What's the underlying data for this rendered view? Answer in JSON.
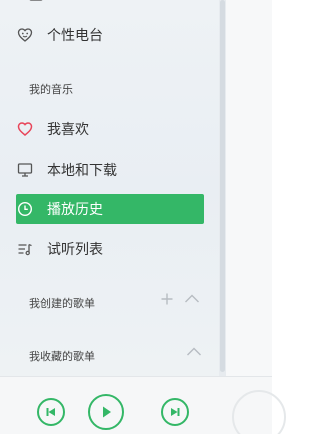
{
  "sidebar": {
    "top_items": [
      {
        "label": "个性电台",
        "icon": "radio-icon"
      }
    ],
    "my_music_title": "我的音乐",
    "my_music_items": [
      {
        "label": "我喜欢",
        "icon": "heart-icon"
      },
      {
        "label": "本地和下载",
        "icon": "monitor-icon"
      },
      {
        "label": "播放历史",
        "icon": "clock-icon",
        "active": true
      },
      {
        "label": "试听列表",
        "icon": "playlist-icon"
      }
    ],
    "created_playlists_title": "我创建的歌单",
    "collected_playlists_title": "我收藏的歌单"
  },
  "player": {
    "prev_icon": "previous-track-icon",
    "play_icon": "play-icon",
    "next_icon": "next-track-icon"
  },
  "colors": {
    "accent": "#34b767",
    "heart": "#e8455a",
    "muted": "#b7bcc2"
  }
}
